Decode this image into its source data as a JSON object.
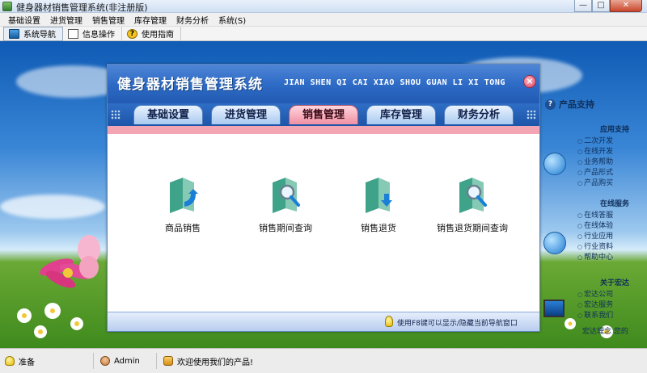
{
  "window": {
    "title": "健身器材销售管理系统(非注册版)",
    "controls": {
      "minimize": "—",
      "maximize": "□",
      "close": "✕"
    }
  },
  "menu": [
    "基础设置",
    "进货管理",
    "销售管理",
    "库存管理",
    "财务分析",
    "系统(S)"
  ],
  "toolbar": {
    "items": [
      {
        "label": "系统导航",
        "icon": "monitor-icon"
      },
      {
        "label": "信息操作",
        "icon": "document-icon"
      },
      {
        "label": "使用指南",
        "icon": "help-icon"
      }
    ]
  },
  "dialog": {
    "title": "健身器材销售管理系统",
    "pinyin": "JIAN SHEN QI CAI XIAO SHOU GUAN LI XI TONG",
    "close": "×",
    "tabs": [
      {
        "label": "基础设置",
        "active": false
      },
      {
        "label": "进货管理",
        "active": false
      },
      {
        "label": "销售管理",
        "active": true
      },
      {
        "label": "库存管理",
        "active": false
      },
      {
        "label": "财务分析",
        "active": false
      }
    ],
    "functions": [
      {
        "label": "商品销售",
        "icon": "folder-arrow-icon"
      },
      {
        "label": "销售期间查询",
        "icon": "folder-search-icon"
      },
      {
        "label": "销售退货",
        "icon": "folder-down-icon"
      },
      {
        "label": "销售退货期间查询",
        "icon": "folder-search-icon"
      }
    ],
    "footer": "使用F8键可以显示/隐藏当前导航窗口"
  },
  "sidebar": {
    "title": "产品支持",
    "sections": [
      {
        "title": "应用支持",
        "items": [
          "二次开发",
          "在线开发",
          "业务帮助",
          "产品形式",
          "产品购买"
        ]
      },
      {
        "title": "在线服务",
        "items": [
          "在线答服",
          "在线体验",
          "行业应用",
          "行业资料",
          "帮助中心"
        ]
      },
      {
        "title": "关于宏达",
        "items": [
          "宏达公司",
          "宏达服务",
          "联系我们"
        ]
      }
    ],
    "slogan": "宏达理念 您的"
  },
  "status": {
    "state": "准备",
    "user": "Admin",
    "message": "欢迎使用我们的产品!"
  },
  "colors": {
    "accent_blue": "#2e6bc6",
    "active_tab_pink": "#ef8fa3",
    "pink_band": "#f4a5b4"
  }
}
